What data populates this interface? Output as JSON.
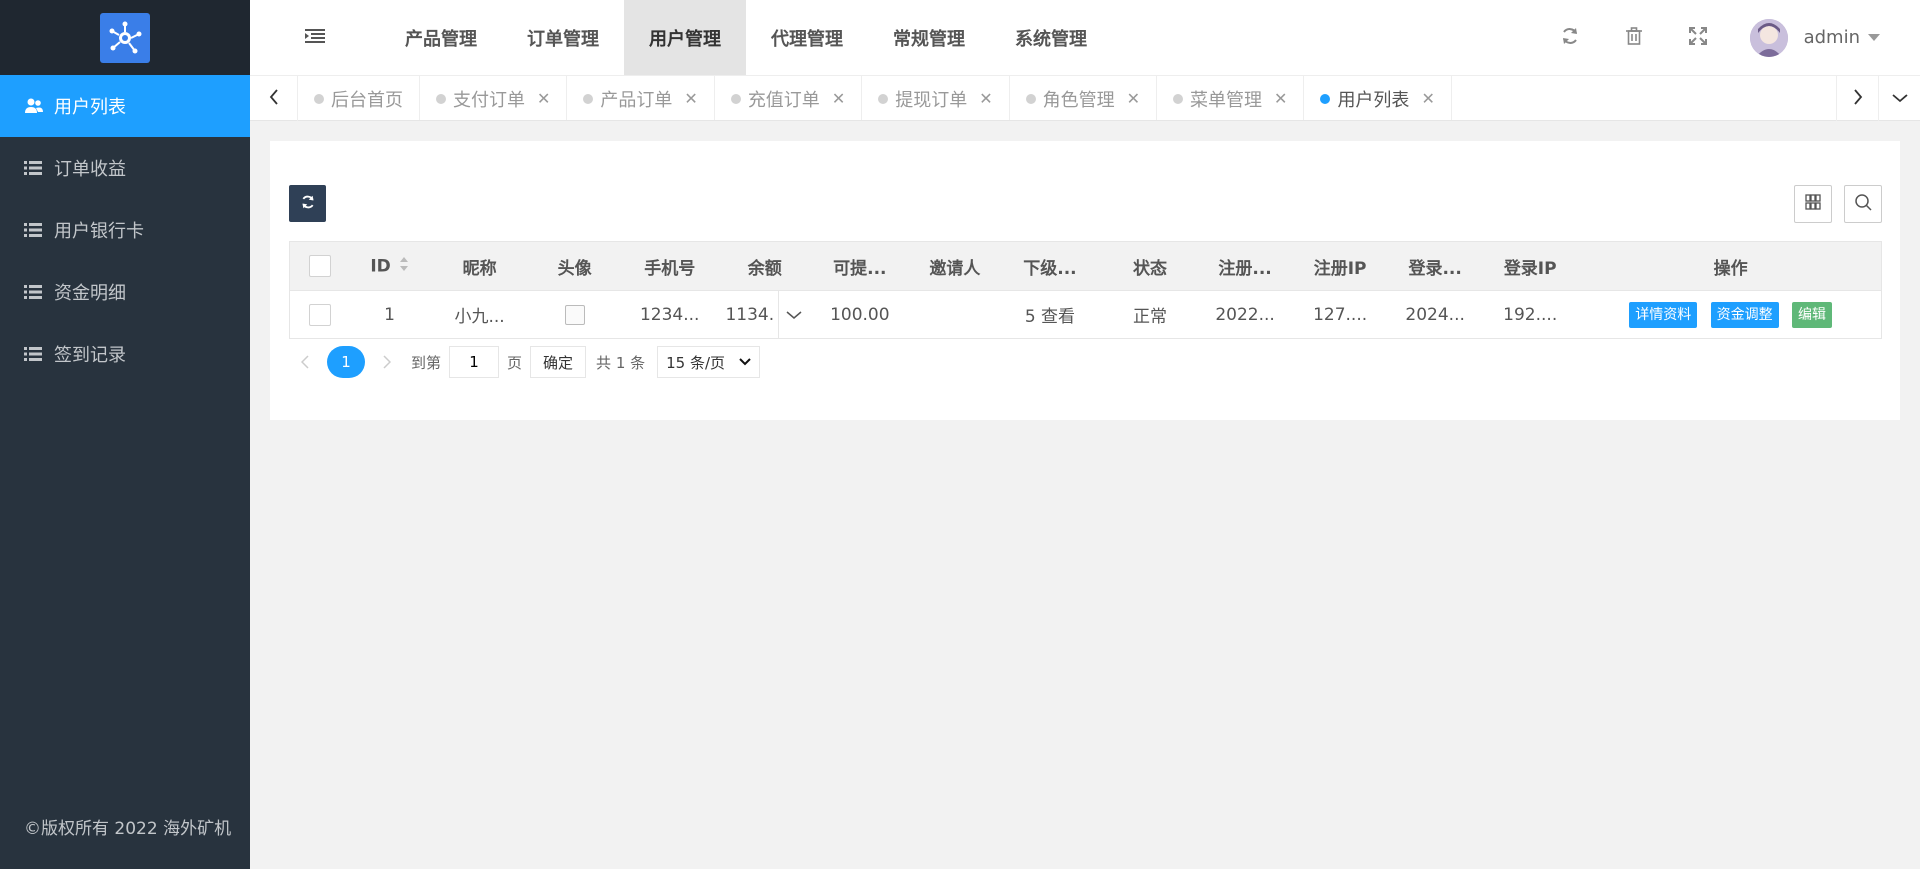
{
  "sidebar": {
    "items": [
      {
        "label": "用户列表",
        "icon": "users-icon",
        "active": true
      },
      {
        "label": "订单收益",
        "icon": "list-icon"
      },
      {
        "label": "用户银行卡",
        "icon": "list-icon"
      },
      {
        "label": "资金明细",
        "icon": "list-icon"
      },
      {
        "label": "签到记录",
        "icon": "list-icon"
      }
    ],
    "copyright": "©版权所有 2022 海外矿机"
  },
  "header": {
    "nav": [
      "产品管理",
      "订单管理",
      "用户管理",
      "代理管理",
      "常规管理",
      "系统管理"
    ],
    "active_nav": "用户管理",
    "username": "admin"
  },
  "tabs": [
    {
      "label": "后台首页",
      "closable": false
    },
    {
      "label": "支付订单",
      "closable": true
    },
    {
      "label": "产品订单",
      "closable": true
    },
    {
      "label": "充值订单",
      "closable": true
    },
    {
      "label": "提现订单",
      "closable": true
    },
    {
      "label": "角色管理",
      "closable": true
    },
    {
      "label": "菜单管理",
      "closable": true
    },
    {
      "label": "用户列表",
      "closable": true,
      "active": true
    }
  ],
  "table": {
    "columns": [
      "ID",
      "昵称",
      "头像",
      "手机号",
      "余额",
      "可提...",
      "邀请人",
      "下级...",
      "状态",
      "注册...",
      "注册IP",
      "登录...",
      "登录IP",
      "操作"
    ],
    "rows": [
      {
        "id": "1",
        "nickname": "小九...",
        "phone": "1234...",
        "balance": "1134.",
        "withdrawable": "100.00",
        "inviter": "",
        "subordinates": "5 查看",
        "status": "正常",
        "reg_time": "2022...",
        "reg_ip": "127....",
        "login_time": "2024...",
        "login_ip": "192...."
      }
    ],
    "actions": [
      "详情资料",
      "资金调整",
      "编辑"
    ]
  },
  "pager": {
    "current_page": "1",
    "goto_label": "到第",
    "goto_value": "1",
    "page_label": "页",
    "confirm": "确定",
    "total": "共 1 条",
    "page_size": "15 条/页"
  },
  "colors": {
    "sidebar_bg": "#28333e",
    "accent": "#1e9fff",
    "edit_green": "#5fb878"
  }
}
